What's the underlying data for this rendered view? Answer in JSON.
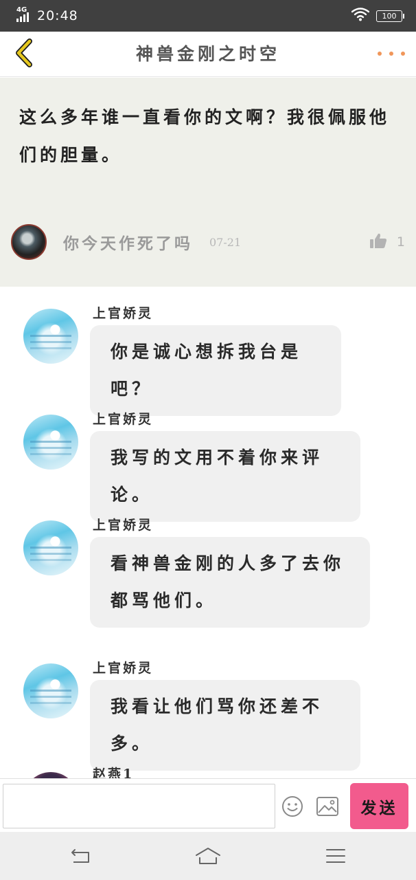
{
  "status_bar": {
    "network": "4G",
    "time": "20:48",
    "battery": "100",
    "wifi_icon": "wifi-icon"
  },
  "header": {
    "title": "神兽金刚之时空",
    "back_icon": "chevron-left-icon",
    "more_icon": "more-dots-icon"
  },
  "origin_comment": {
    "text": "这么多年谁一直看你的文啊？我很佩服他们的胆量。",
    "author": "你今天作死了吗",
    "date": "07-21",
    "likes": "1"
  },
  "replies": [
    {
      "name": "上官娇灵",
      "text": "你是诚心想拆我台是吧？"
    },
    {
      "name": "上官娇灵",
      "text": "我写的文用不着你来评论。"
    },
    {
      "name": "上官娇灵",
      "text": "看神兽金刚的人多了去你都骂他们。"
    },
    {
      "name": "上官娇灵",
      "text": "我看让他们骂你还差不多。"
    },
    {
      "name": "赵燕1",
      "text": ""
    }
  ],
  "input_bar": {
    "placeholder": "",
    "send_label": "发送",
    "emoji_icon": "emoji-icon",
    "image_icon": "image-icon"
  },
  "nav_bar": {
    "icons": [
      "back-icon",
      "home-icon",
      "menu-icon"
    ]
  },
  "colors": {
    "status_bar_bg": "#404040",
    "origin_bg": "#eff0ea",
    "accent_dots": "#f0965a",
    "back_arrow": "#e6c81e",
    "send_button": "#f25b8d",
    "bubble_bg": "#f0f0f0"
  }
}
